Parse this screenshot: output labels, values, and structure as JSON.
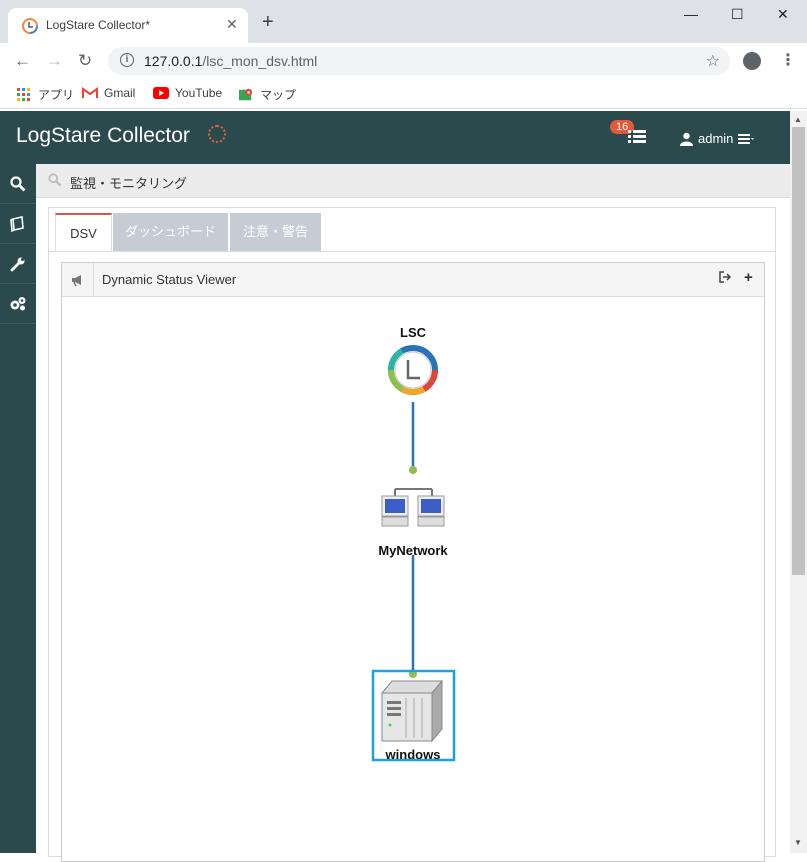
{
  "browser": {
    "tab_title": "LogStare Collector*",
    "url_host": "127.0.0.1",
    "url_path": "/lsc_mon_dsv.html",
    "bookmarks": [
      "アプリ",
      "Gmail",
      "YouTube",
      "マップ"
    ]
  },
  "app": {
    "brand": "LogStare Collector",
    "badge_count": "16",
    "user": "admin",
    "accent": "#2b4a4d"
  },
  "breadcrumb": "監視・モニタリング",
  "tabs": [
    "DSV",
    "ダッシュボード",
    "注意・警告"
  ],
  "viewer": {
    "title": "Dynamic Status Viewer"
  },
  "nodes": {
    "root": "LSC",
    "network": "MyNetwork",
    "host": "windows"
  },
  "colors": {
    "link": "#2a73b8",
    "dot": "#8fc04a",
    "selection": "#1aa3e0"
  }
}
